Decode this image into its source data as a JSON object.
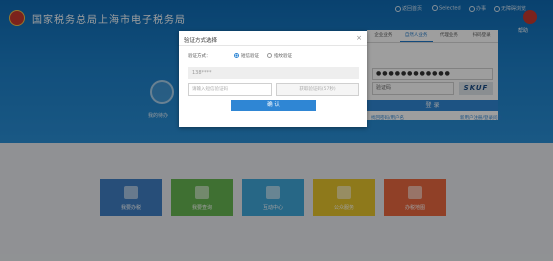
{
  "header": {
    "site_title": "国家税务总局上海市电子税务局",
    "links": [
      {
        "label": "返回首页"
      },
      {
        "label": "Selected"
      },
      {
        "label": "办事"
      },
      {
        "label": "无障碍浏览"
      }
    ],
    "help_label": "帮助"
  },
  "hero": {
    "label": "我的待办"
  },
  "login": {
    "tabs": [
      {
        "label": "企业业务"
      },
      {
        "label": "自然人业务"
      },
      {
        "label": "代理业务"
      },
      {
        "label": "扫码登录"
      }
    ],
    "password_value": "●●●●●●●●●●●●",
    "code_placeholder": "验证码",
    "captcha_text": "SKUF",
    "login_button": "登 录",
    "link_left": "找回密码/用户名",
    "link_right": "新用户注册/登录问题"
  },
  "tiles": [
    {
      "label": "我要办税",
      "color": "#3f7fc3"
    },
    {
      "label": "我要查询",
      "color": "#66b552"
    },
    {
      "label": "互动中心",
      "color": "#3fa7d9"
    },
    {
      "label": "公众服务",
      "color": "#e6c42c"
    },
    {
      "label": "办税地图",
      "color": "#e8683f"
    }
  ],
  "modal": {
    "title": "验证方式选择",
    "close_glyph": "×",
    "method_label": "验证方式：",
    "options": [
      {
        "label": "短信验证",
        "selected": true
      },
      {
        "label": "指纹验证",
        "selected": false
      }
    ],
    "phone_value": "138****",
    "code_placeholder": "请输入短信验证码",
    "get_code_button": "获取验证码(57秒)",
    "confirm_button": "确 认"
  }
}
